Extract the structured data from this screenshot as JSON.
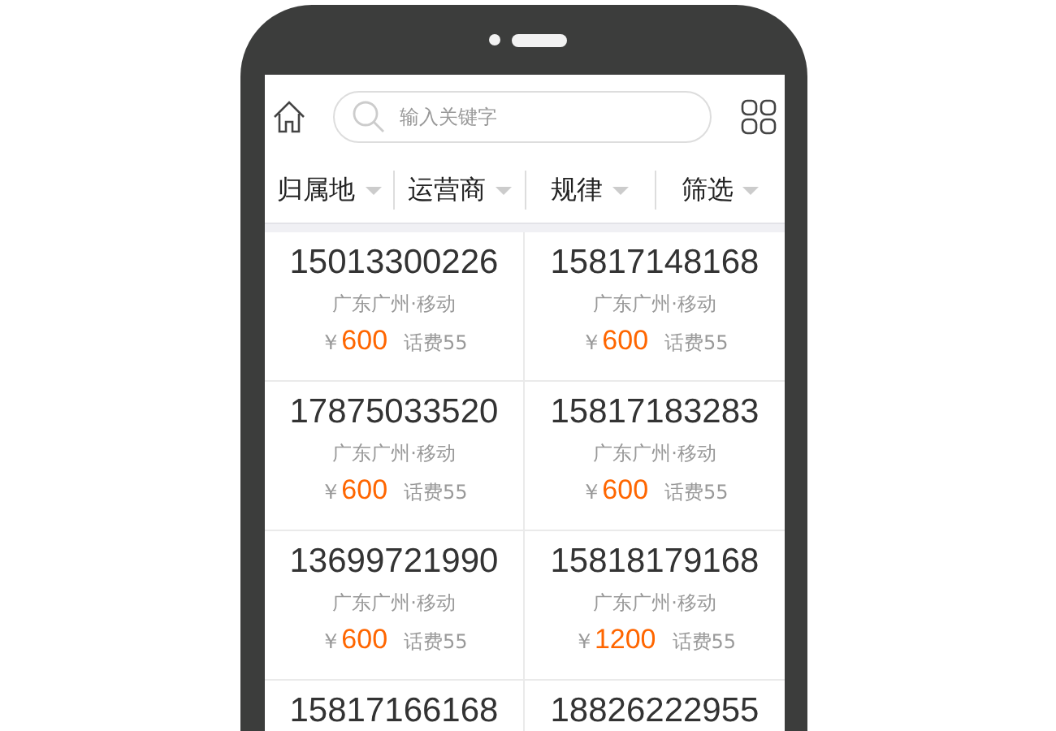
{
  "search": {
    "placeholder": "输入关键字"
  },
  "filters": [
    {
      "label": "归属地"
    },
    {
      "label": "运营商"
    },
    {
      "label": "规律"
    },
    {
      "label": "筛选"
    }
  ],
  "numbers": [
    {
      "number": "15013300226",
      "location": "广东广州·移动",
      "currency": "￥",
      "price": "600",
      "fee": "话费55"
    },
    {
      "number": "15817148168",
      "location": "广东广州·移动",
      "currency": "￥",
      "price": "600",
      "fee": "话费55"
    },
    {
      "number": "17875033520",
      "location": "广东广州·移动",
      "currency": "￥",
      "price": "600",
      "fee": "话费55"
    },
    {
      "number": "15817183283",
      "location": "广东广州·移动",
      "currency": "￥",
      "price": "600",
      "fee": "话费55"
    },
    {
      "number": "13699721990",
      "location": "广东广州·移动",
      "currency": "￥",
      "price": "600",
      "fee": "话费55"
    },
    {
      "number": "15818179168",
      "location": "广东广州·移动",
      "currency": "￥",
      "price": "1200",
      "fee": "话费55"
    },
    {
      "number": "15817166168"
    },
    {
      "number": "18826222955"
    }
  ]
}
